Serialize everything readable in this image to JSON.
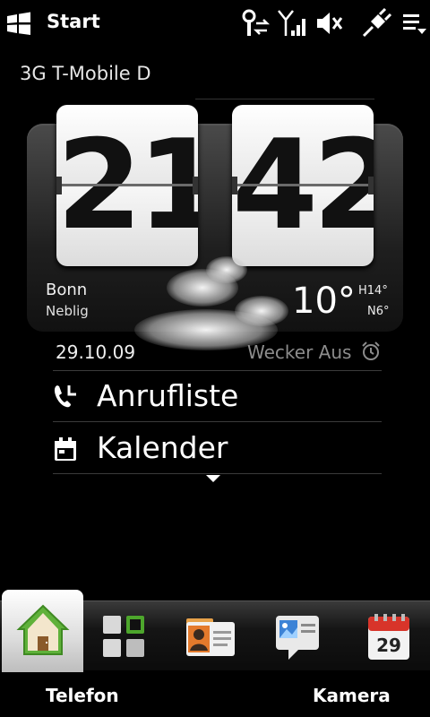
{
  "status_bar": {
    "start_label": "Start",
    "icons": [
      "windows-flag-icon",
      "antenna-sync-icon",
      "signal-strength-icon",
      "speaker-muted-icon",
      "usb-connection-icon",
      "menu-icon"
    ]
  },
  "operator": "3G T-Mobile D",
  "clock": {
    "hours": "21",
    "minutes": "42"
  },
  "weather": {
    "city": "Bonn",
    "condition": "Neblig",
    "temperature": "10°",
    "high": "H14°",
    "low": "N6°"
  },
  "date": "29.10.09",
  "alarm_status": "Wecker Aus",
  "shortcuts": [
    {
      "label": "Anrufliste",
      "icon": "call-history-icon"
    },
    {
      "label": "Kalender",
      "icon": "calendar-icon"
    }
  ],
  "tabs": [
    {
      "name": "home",
      "icon": "home-icon"
    },
    {
      "name": "favorites",
      "icon": "favorites-grid-icon"
    },
    {
      "name": "people",
      "icon": "contact-card-icon"
    },
    {
      "name": "messages",
      "icon": "message-icon"
    },
    {
      "name": "calendar",
      "icon": "calendar-tab-icon",
      "day": "29"
    }
  ],
  "softkeys": {
    "left": "Telefon",
    "right": "Kamera"
  },
  "colors": {
    "background": "#000000",
    "home_tab_green": "#5fb13a",
    "calendar_red": "#d8342a",
    "alarm_gray": "#8c8c8c"
  }
}
